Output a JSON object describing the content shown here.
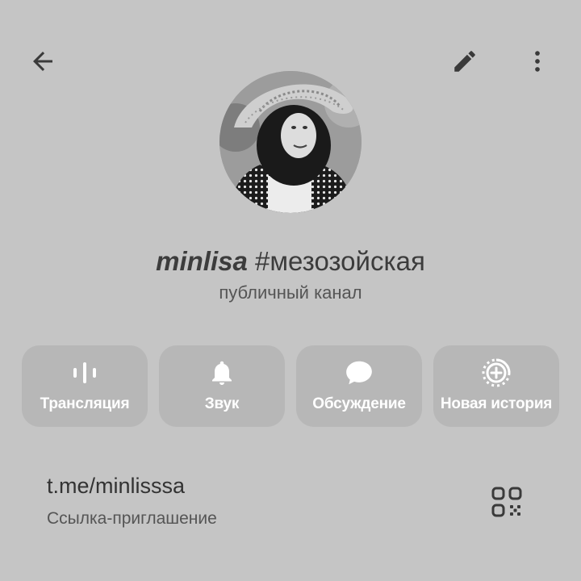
{
  "header": {
    "back_icon": "arrow-left-icon",
    "edit_icon": "pencil-icon",
    "more_icon": "more-vertical-icon"
  },
  "channel": {
    "name": "minlisa",
    "title_rest": " #мезозойская",
    "type_label": "публичный канал"
  },
  "actions": [
    {
      "label": "Трансляция",
      "icon": "live-stream-icon"
    },
    {
      "label": "Звук",
      "icon": "bell-icon"
    },
    {
      "label": "Обсуждение",
      "icon": "chat-bubble-icon"
    },
    {
      "label": "Новая история",
      "icon": "add-story-icon"
    }
  ],
  "invite": {
    "url": "t.me/minlisssa",
    "caption": "Ссылка-приглашение",
    "qr_icon": "qr-code-icon"
  },
  "colors": {
    "background": "#c5c5c5",
    "tile": "#b7b7b7",
    "icon": "#454545"
  }
}
